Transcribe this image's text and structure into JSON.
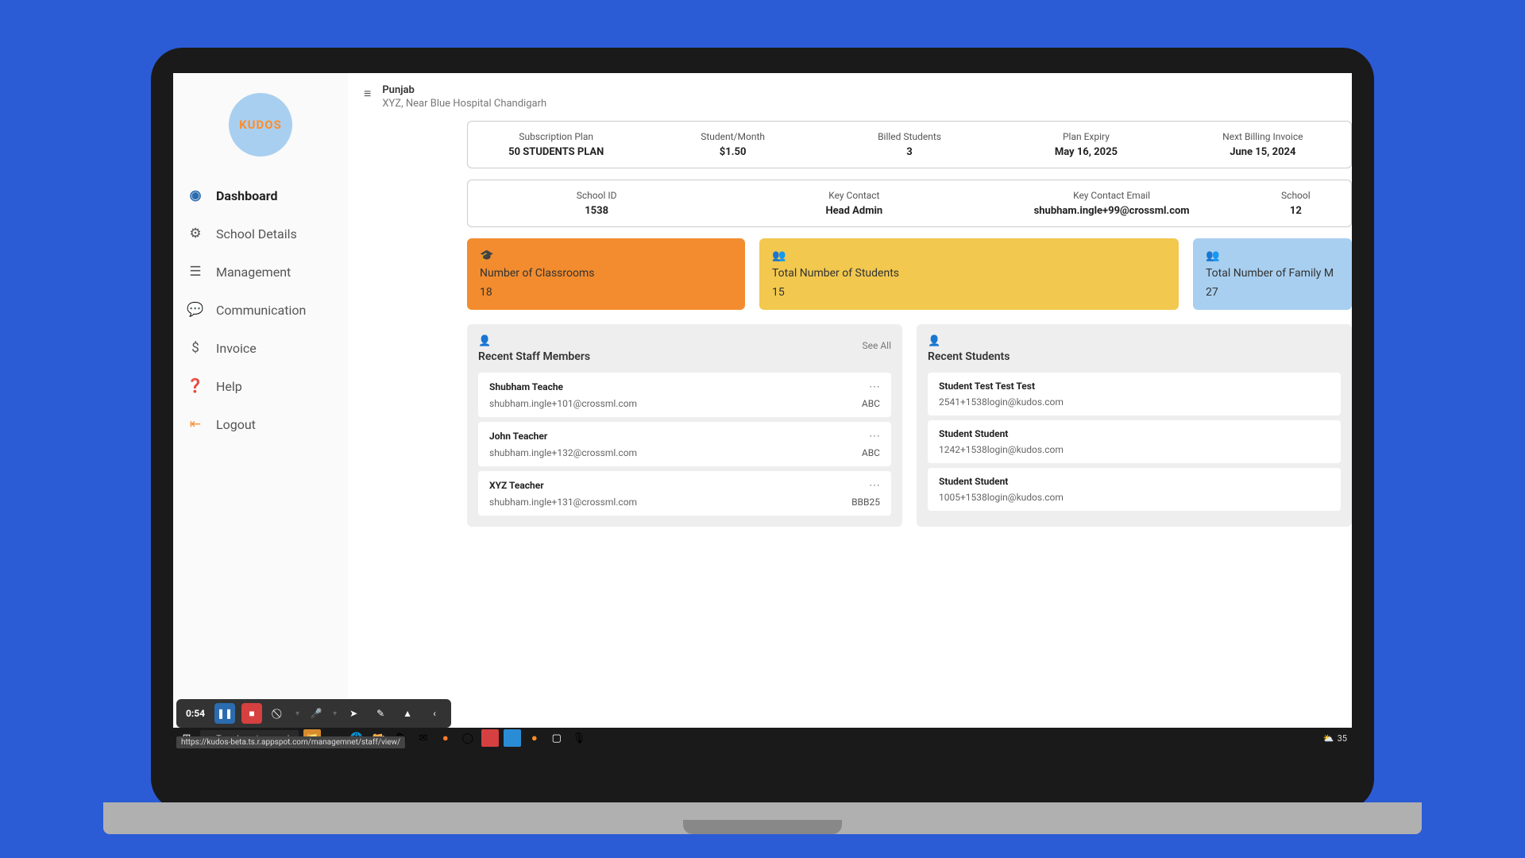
{
  "logo": "KUDOS",
  "nav": {
    "dashboard": "Dashboard",
    "school_details": "School Details",
    "management": "Management",
    "communication": "Communication",
    "invoice": "Invoice",
    "help": "Help",
    "logout": "Logout"
  },
  "header": {
    "region": "Punjab",
    "address": "XYZ, Near Blue Hospital Chandigarh"
  },
  "subscription": {
    "plan_label": "Subscription Plan",
    "plan_value": "50 STUDENTS PLAN",
    "rate_label": "Student/Month",
    "rate_value": "$1.50",
    "billed_label": "Billed Students",
    "billed_value": "3",
    "expiry_label": "Plan Expiry",
    "expiry_value": "May 16, 2025",
    "invoice_label": "Next Billing Invoice",
    "invoice_value": "June 15, 2024"
  },
  "school": {
    "id_label": "School ID",
    "id_value": "1538",
    "contact_label": "Key Contact",
    "contact_value": "Head Admin",
    "email_label": "Key Contact Email",
    "email_value": "shubham.ingle+99@crossml.com",
    "extra_label": "School",
    "extra_value": "12"
  },
  "stats": {
    "classrooms_label": "Number of Classrooms",
    "classrooms_value": "18",
    "students_label": "Total Number of Students",
    "students_value": "15",
    "family_label": "Total Number of Family M",
    "family_value": "27"
  },
  "staff_panel": {
    "title": "Recent Staff Members",
    "see_all": "See All",
    "items": [
      {
        "name": "Shubham Teache",
        "email": "shubham.ingle+101@crossml.com",
        "code": "ABC"
      },
      {
        "name": "John Teacher",
        "email": "shubham.ingle+132@crossml.com",
        "code": "ABC"
      },
      {
        "name": "XYZ Teacher",
        "email": "shubham.ingle+131@crossml.com",
        "code": "BBB25"
      }
    ]
  },
  "students_panel": {
    "title": "Recent Students",
    "items": [
      {
        "name": "Student Test Test Test",
        "email": "2541+1538login@kudos.com"
      },
      {
        "name": "Student Student",
        "email": "1242+1538login@kudos.com"
      },
      {
        "name": "Student Student",
        "email": "1005+1538login@kudos.com"
      }
    ]
  },
  "recorder": {
    "time": "0:54"
  },
  "tooltip_url": "https://kudos-beta.ts.r.appspot.com/managemnet/staff/view/",
  "taskbar": {
    "search_placeholder": "Type here to search",
    "tray_temp": "35"
  }
}
